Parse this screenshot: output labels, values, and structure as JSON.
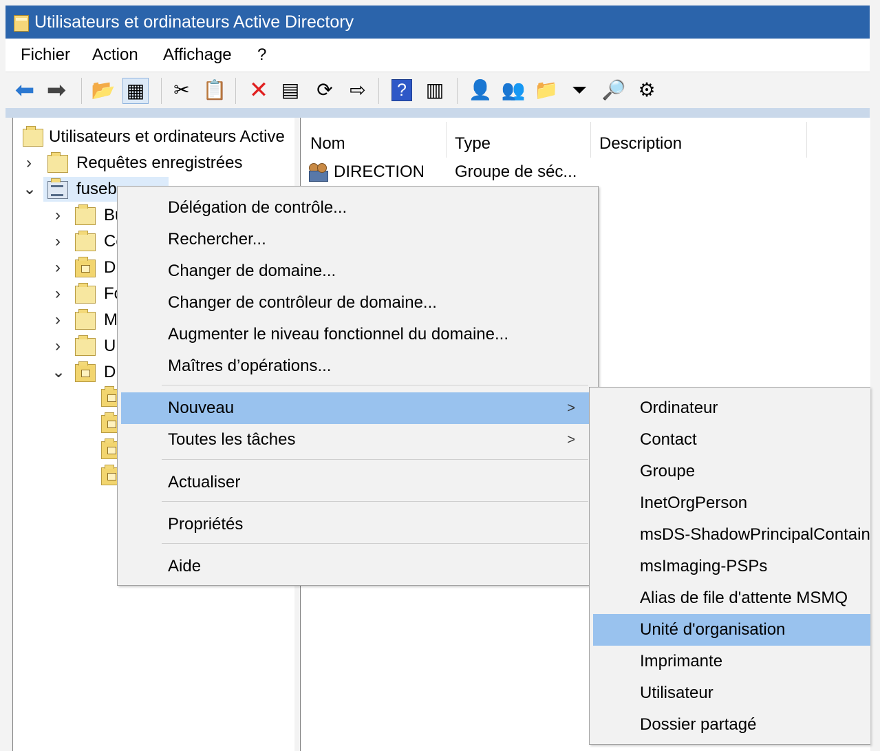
{
  "window": {
    "title": "Utilisateurs et ordinateurs Active Directory"
  },
  "menu": {
    "items": [
      "Fichier",
      "Action",
      "Affichage",
      "?"
    ]
  },
  "toolbar": {
    "icons": [
      "back-arrow-icon",
      "forward-arrow-icon",
      "up-folder-icon",
      "show-hide-console-tree-icon",
      "cut-icon",
      "paste-icon",
      "delete-icon",
      "properties-icon",
      "refresh-icon",
      "export-list-icon",
      "help-icon",
      "show-action-pane-icon",
      "new-user-icon",
      "new-group-icon",
      "new-ou-icon",
      "filter-icon",
      "find-icon",
      "delegate-icon"
    ]
  },
  "tree": {
    "root": "Utilisateurs et ordinateurs Active",
    "saved_queries": "Requêtes enregistrées",
    "domain": "fuseb",
    "children": [
      "Bu",
      "Co",
      "D",
      "Fo",
      "M",
      "U",
      "D"
    ]
  },
  "list": {
    "columns": [
      "Nom",
      "Type",
      "Description"
    ],
    "rows": [
      {
        "name": "DIRECTION",
        "type": "Groupe de séc..."
      }
    ]
  },
  "context_menu": {
    "items": [
      "Délégation de contrôle...",
      "Rechercher...",
      "Changer de domaine...",
      "Changer de contrôleur de domaine...",
      "Augmenter le niveau fonctionnel du domaine...",
      "Maîtres d’opérations...",
      "Nouveau",
      "Toutes les tâches",
      "Actualiser",
      "Propriétés",
      "Aide"
    ],
    "selected": "Nouveau",
    "submenu_arrow": ">"
  },
  "submenu": {
    "items": [
      "Ordinateur",
      "Contact",
      "Groupe",
      "InetOrgPerson",
      "msDS-ShadowPrincipalContain",
      "msImaging-PSPs",
      "Alias de file d'attente MSMQ",
      "Unité d'organisation",
      "Imprimante",
      "Utilisateur",
      "Dossier partagé"
    ],
    "selected": "Unité d'organisation"
  },
  "colors": {
    "title_bar": "#2b64ab",
    "menu_selection": "#99c2ee",
    "pane_strip": "#c9d8ea"
  }
}
